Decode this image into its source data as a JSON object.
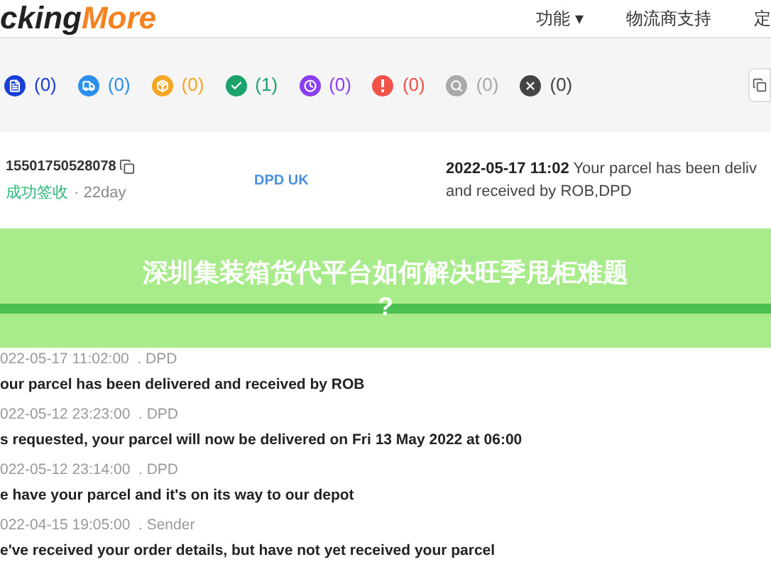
{
  "header": {
    "logo_dark": "cking",
    "logo_accent": "More",
    "nav": [
      "功能 ▾",
      "物流商支持",
      "定"
    ]
  },
  "status_filters": [
    {
      "kind": "document",
      "count": "(0)",
      "color": "#1a3fd6"
    },
    {
      "kind": "truck",
      "count": "(0)",
      "color": "#2b8ff0"
    },
    {
      "kind": "box",
      "count": "(0)",
      "color": "#f5a623"
    },
    {
      "kind": "check",
      "count": "(1)",
      "color": "#1aa36a"
    },
    {
      "kind": "clock",
      "count": "(0)",
      "color": "#8b3ff0"
    },
    {
      "kind": "alert",
      "count": "(0)",
      "color": "#f0524a"
    },
    {
      "kind": "search",
      "count": "(0)",
      "color": "#a9a9a9"
    },
    {
      "kind": "cross",
      "count": "(0)",
      "color": "#444444"
    }
  ],
  "shipment": {
    "number": "15501750528078",
    "status": "成功签收",
    "age": "· 22day",
    "carrier": "DPD UK",
    "latest_time": "2022-05-17 11:02",
    "latest_text_1": "Your parcel has been deliv",
    "latest_text_2": "and received by ROB,DPD"
  },
  "banner": {
    "title": "深圳集装箱货代平台如何解决旺季甩柜难题",
    "title_end": "?"
  },
  "events": [
    {
      "meta": "022-05-17 11:02:00  . DPD",
      "text": "our parcel has been delivered and received by ROB"
    },
    {
      "meta": "022-05-12 23:23:00  . DPD",
      "text": "s requested, your parcel will now be delivered on Fri 13 May 2022 at 06:00"
    },
    {
      "meta": "022-05-12 23:14:00  . DPD",
      "text": "e have your parcel and it's on its way to our depot"
    },
    {
      "meta": "022-04-15 19:05:00  . Sender",
      "text": "e've received your order details, but have not yet received your parcel"
    }
  ]
}
